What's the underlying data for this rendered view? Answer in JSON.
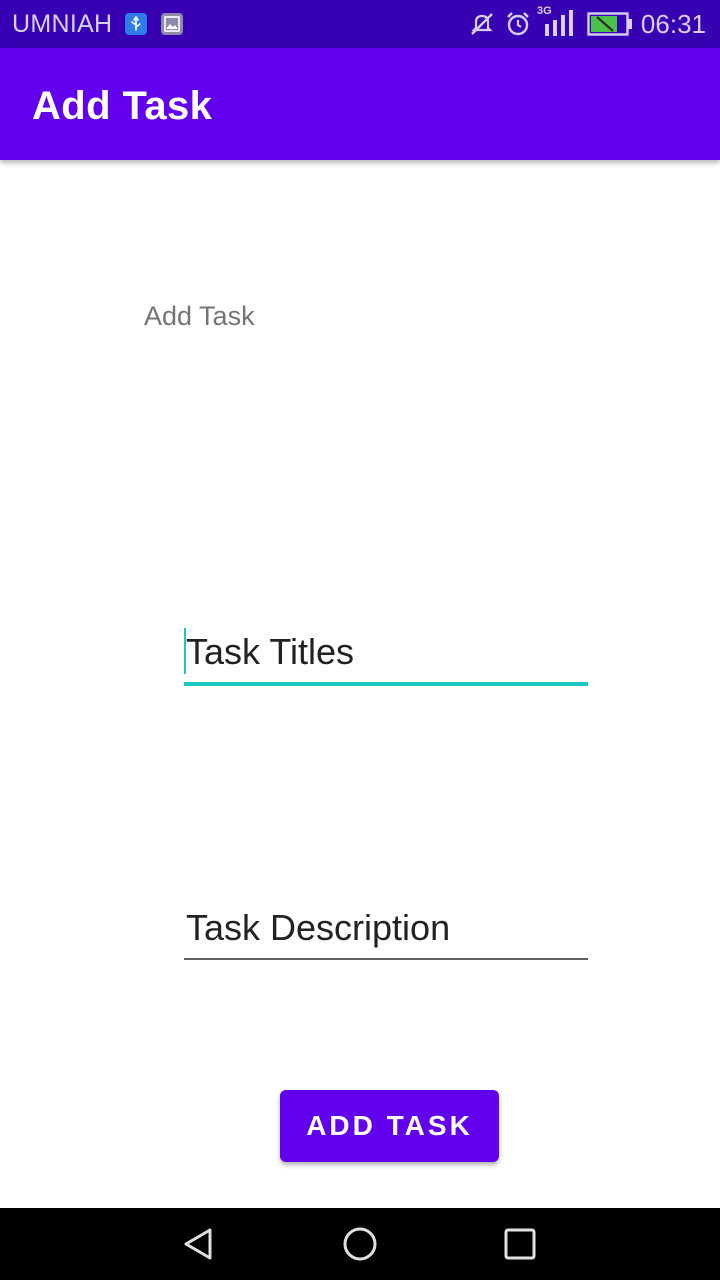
{
  "status_bar": {
    "carrier": "UMNIAH",
    "network": "3G",
    "time": "06:31",
    "icons": [
      "usb-icon",
      "image-icon",
      "mute-icon",
      "alarm-icon",
      "signal-icon",
      "battery-icon"
    ]
  },
  "app_bar": {
    "title": "Add Task"
  },
  "form": {
    "heading": "Add Task",
    "title_field": {
      "value": "Task Titles"
    },
    "description_field": {
      "value": "Task Description"
    },
    "submit_label": "ADD TASK"
  },
  "nav_bar": {
    "icons": [
      "back-icon",
      "home-icon",
      "recents-icon"
    ]
  },
  "colors": {
    "status_bar": "#3700b3",
    "primary": "#6200ee",
    "accent": "#1ec8c0"
  }
}
